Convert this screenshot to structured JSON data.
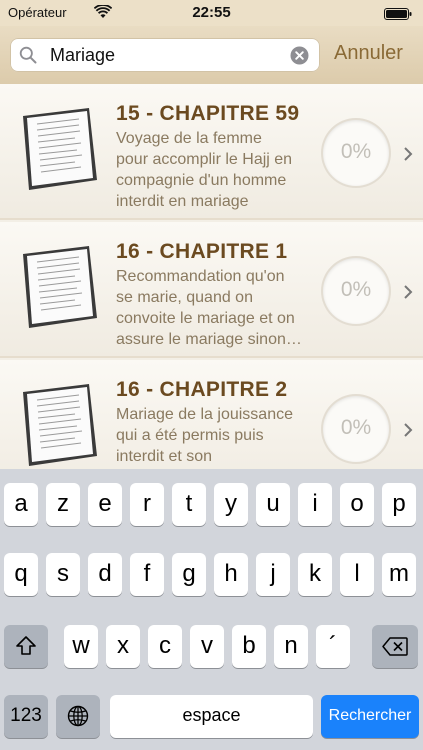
{
  "status_bar": {
    "carrier": "Opérateur",
    "time": "22:55"
  },
  "search": {
    "value": "Mariage",
    "cancel_label": "Annuler"
  },
  "results": [
    {
      "title": "15 - CHAPITRE 59",
      "desc_lines": [
        "Voyage de la femme",
        "pour accomplir le Hajj en",
        "compagnie d'un homme",
        "interdit en mariage"
      ],
      "progress": "0%"
    },
    {
      "title": "16 - CHAPITRE 1",
      "desc_lines": [
        "Recommandation qu'on",
        "se marie, quand on",
        "convoite le mariage et on",
        "assure le mariage sinon…"
      ],
      "progress": "0%"
    },
    {
      "title": "16 - CHAPITRE 2",
      "desc_lines": [
        "Mariage de la jouissance",
        "qui a été permis puis",
        "interdit et son"
      ],
      "progress": "0%"
    }
  ],
  "keyboard": {
    "row1": [
      "a",
      "z",
      "e",
      "r",
      "t",
      "y",
      "u",
      "i",
      "o",
      "p"
    ],
    "row2": [
      "q",
      "s",
      "d",
      "f",
      "g",
      "h",
      "j",
      "k",
      "l",
      "m"
    ],
    "row3": [
      "w",
      "x",
      "c",
      "v",
      "b",
      "n",
      "´"
    ],
    "numbers_label": "123",
    "space_label": "espace",
    "return_label": "Rechercher"
  },
  "colors": {
    "accent_brown": "#6b4a20",
    "cancel_brown": "#8a6a36",
    "return_blue": "#1a82fb"
  }
}
